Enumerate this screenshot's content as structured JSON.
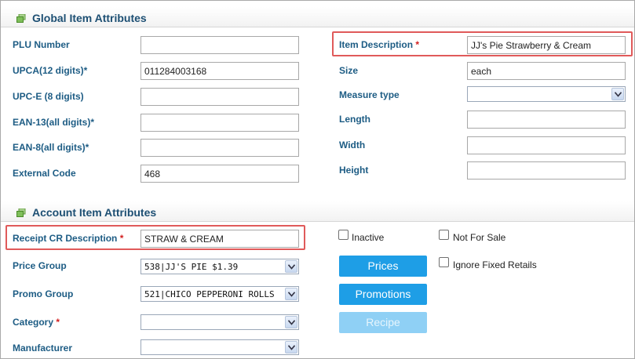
{
  "global_section": {
    "title": "Global Item Attributes",
    "fields": {
      "plu": {
        "label": "PLU Number",
        "value": ""
      },
      "upca": {
        "label": "UPCA(12 digits)*",
        "value": "011284003168"
      },
      "upce": {
        "label": "UPC-E (8 digits)",
        "value": ""
      },
      "ean13": {
        "label": "EAN-13(all digits)*",
        "value": ""
      },
      "ean8": {
        "label": "EAN-8(all digits)*",
        "value": ""
      },
      "external_code": {
        "label": "External Code",
        "value": "468"
      },
      "item_description": {
        "label": "Item Description",
        "required_mark": "*",
        "value": "JJ's Pie Strawberry & Cream"
      },
      "size": {
        "label": "Size",
        "value": "each"
      },
      "measure_type": {
        "label": "Measure type",
        "value": ""
      },
      "length": {
        "label": "Length",
        "value": ""
      },
      "width": {
        "label": "Width",
        "value": ""
      },
      "height": {
        "label": "Height",
        "value": ""
      }
    }
  },
  "account_section": {
    "title": "Account Item Attributes",
    "fields": {
      "receipt_cr": {
        "label": "Receipt CR Description",
        "required_mark": "*",
        "value": "STRAW & CREAM"
      },
      "price_group": {
        "label": "Price Group",
        "value": "538|JJ'S PIE $1.39"
      },
      "promo_group": {
        "label": "Promo Group",
        "value": "521|CHICO PEPPERONI ROLLS"
      },
      "category": {
        "label": "Category",
        "required_mark": "*",
        "value": ""
      },
      "manufacturer": {
        "label": "Manufacturer",
        "value": ""
      }
    },
    "checkboxes": {
      "inactive": "Inactive",
      "not_for_sale": "Not For Sale",
      "ignore_fixed_retails": "Ignore Fixed Retails"
    },
    "buttons": {
      "prices": "Prices",
      "promotions": "Promotions",
      "recipe": "Recipe"
    }
  },
  "colors": {
    "label": "#1d5c84",
    "header_title": "#1d4f73",
    "required": "#d21f1f",
    "button": "#1e9ee6",
    "button_disabled": "#8fd0f5",
    "highlight": "#e05a5a"
  },
  "icons": {
    "section": "section-stack-icon",
    "dropdown": "chevron-down-icon"
  }
}
